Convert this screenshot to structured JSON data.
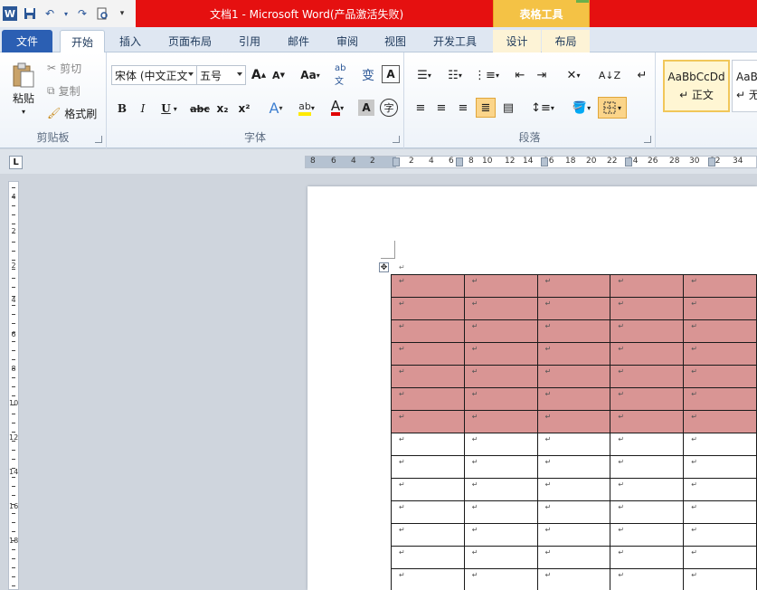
{
  "titlebar": {
    "doc_title": "文档1 - Microsoft Word(产品激活失败)",
    "tool_header": "表格工具",
    "brand_color": "#e51010",
    "qat": [
      "word-logo",
      "save-icon",
      "undo-icon",
      "redo-icon",
      "print-preview-icon",
      "customize-icon"
    ]
  },
  "tabs": {
    "file": "文件",
    "home": "开始",
    "insert": "插入",
    "layout": "页面布局",
    "references": "引用",
    "mailings": "邮件",
    "review": "审阅",
    "view": "视图",
    "developer": "开发工具",
    "design": "设计",
    "table_layout": "布局"
  },
  "ribbon": {
    "clipboard": {
      "label": "剪贴板",
      "paste": "粘贴",
      "cut": "剪切",
      "copy": "复制",
      "format_painter": "格式刷"
    },
    "font": {
      "label": "字体",
      "font_name": "宋体 (中文正文",
      "font_size": "五号",
      "grow": "A",
      "shrink": "A",
      "change_case": "Aa",
      "bold": "B",
      "italic": "I",
      "underline": "U",
      "strike": "abc",
      "subscript": "x₂",
      "superscript": "x²",
      "text_effect": "A",
      "font_color": "A",
      "char_shading": "A",
      "enclose": "字"
    },
    "paragraph": {
      "label": "段落"
    },
    "styles": {
      "style1_preview": "AaBbCcDd",
      "style1_name": "↵ 正文",
      "style2_preview": "AaB",
      "style2_name": "↵ 无"
    }
  },
  "ruler": {
    "h_numbers": [
      "8",
      "6",
      "4",
      "2",
      "2",
      "4",
      "6",
      "8",
      "10",
      "12",
      "14",
      "16",
      "18",
      "20",
      "22",
      "24",
      "26",
      "28",
      "30",
      "32",
      "34"
    ],
    "v_numbers": [
      "4",
      "2",
      "2",
      "4",
      "6",
      "8",
      "10",
      "12",
      "14",
      "16",
      "18"
    ]
  },
  "document": {
    "cell_mark": "↵",
    "rows_shaded": 7,
    "rows_plain": 7,
    "cols_visible": 5,
    "shade_color": "#d99594",
    "cells": [
      [
        "↵",
        "↵",
        "↵",
        "↵",
        "↵"
      ],
      [
        "↵",
        "↵",
        "↵",
        "↵",
        "↵"
      ],
      [
        "↵",
        "↵",
        "↵",
        "↵",
        "↵"
      ],
      [
        "↵",
        "↵",
        "↵",
        "↵",
        "↵"
      ],
      [
        "↵",
        "↵",
        "↵",
        "↵",
        "↵"
      ],
      [
        "↵",
        "↵",
        "↵",
        "↵",
        "↵"
      ],
      [
        "↵",
        "↵",
        "↵",
        "↵",
        "↵"
      ],
      [
        "↵",
        "↵",
        "↵",
        "↵",
        "↵"
      ],
      [
        "↵",
        "↵",
        "↵",
        "↵",
        "↵"
      ],
      [
        "↵",
        "↵",
        "↵",
        "↵",
        "↵"
      ],
      [
        "↵",
        "↵",
        "↵",
        "↵",
        "↵"
      ],
      [
        "↵",
        "↵",
        "↵",
        "↵",
        "↵"
      ],
      [
        "↵",
        "↵",
        "↵",
        "↵",
        "↵"
      ],
      [
        "↵",
        "↵",
        "↵",
        "↵",
        "↵"
      ]
    ]
  }
}
